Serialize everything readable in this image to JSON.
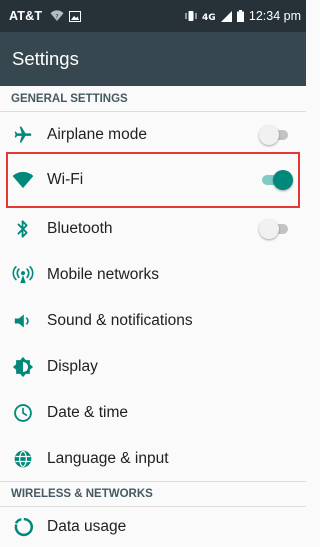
{
  "status_bar": {
    "carrier": "AT&T",
    "time": "12:34 pm",
    "icons": [
      "wifi-question-icon",
      "image-icon",
      "vibrate-icon",
      "network-4g-icon",
      "signal-icon",
      "battery-icon"
    ]
  },
  "app_bar": {
    "title": "Settings"
  },
  "sections": {
    "general": "GENERAL SETTINGS",
    "wireless": "WIRELESS & NETWORKS"
  },
  "items": [
    {
      "label": "Airplane mode",
      "icon": "airplane-icon",
      "toggle": false
    },
    {
      "label": "Wi-Fi",
      "icon": "wifi-icon",
      "toggle": true
    },
    {
      "label": "Bluetooth",
      "icon": "bluetooth-icon",
      "toggle": false
    },
    {
      "label": "Mobile networks",
      "icon": "mobile-network-icon"
    },
    {
      "label": "Sound & notifications",
      "icon": "volume-icon"
    },
    {
      "label": "Display",
      "icon": "display-icon"
    },
    {
      "label": "Date & time",
      "icon": "clock-icon"
    },
    {
      "label": "Language & input",
      "icon": "globe-icon"
    },
    {
      "label": "Data usage",
      "icon": "data-usage-icon"
    }
  ],
  "colors": {
    "status_bar": "#263238",
    "app_bar": "#37474f",
    "accent": "#00897b",
    "highlight": "#e53935"
  }
}
